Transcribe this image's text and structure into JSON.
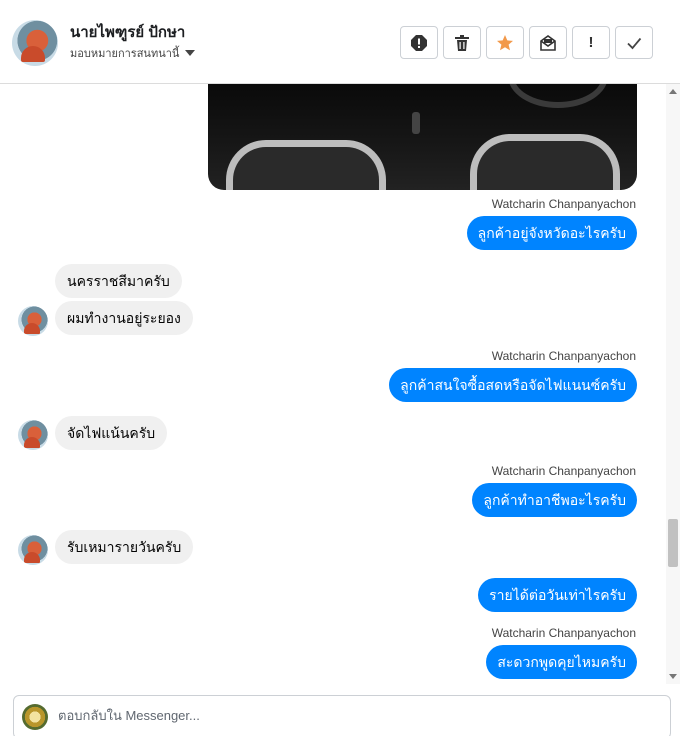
{
  "header": {
    "contact_name": "นายไพฑูรย์ ปักษา",
    "assign_label": "มอบหมายการสนทนานี้",
    "toolbar": [
      {
        "name": "report-icon",
        "title": "report"
      },
      {
        "name": "trash-icon",
        "title": "delete"
      },
      {
        "name": "star-icon",
        "title": "star"
      },
      {
        "name": "mark-unread-icon",
        "title": "mark unread"
      },
      {
        "name": "exclamation-icon",
        "title": "spam",
        "glyph": "!"
      },
      {
        "name": "check-icon",
        "title": "done"
      }
    ],
    "star_color": "#f2994a"
  },
  "messages": {
    "m1_sender": "Watcharin Chanpanyachon",
    "m1_text": "ลูกค้าอยู่จังหวัดอะไรครับ",
    "m2_text": "นครราชสีมาครับ",
    "m3_text": "ผมทำงานอยู่ระยอง",
    "m4_sender": "Watcharin Chanpanyachon",
    "m4_text": "ลูกค้าสนใจซื้อสดหรือจัดไฟแนนซ์ครับ",
    "m5_text": "จัดไฟแน้นครับ",
    "m6_sender": "Watcharin Chanpanyachon",
    "m6_text": "ลูกค้าทำอาชีพอะไรครับ",
    "m7_text": "รับเหมารายวันครับ",
    "m8_text": "รายได้ต่อวันเท่าไรครับ",
    "m9_sender": "Watcharin Chanpanyachon",
    "m9_text": "สะดวกพูดคุยไหมครับ"
  },
  "colors": {
    "outgoing_bubble": "#0084ff",
    "incoming_bubble": "#f0f0f0"
  },
  "reply": {
    "placeholder": "ตอบกลับใน Messenger..."
  }
}
